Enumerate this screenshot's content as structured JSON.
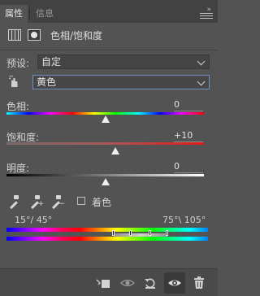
{
  "tabs": [
    {
      "label": "属性",
      "active": true
    },
    {
      "label": "信息",
      "active": false
    }
  ],
  "panel": {
    "title": "色相/饱和度"
  },
  "preset": {
    "label": "预设:",
    "value": "自定"
  },
  "channel": {
    "value": "黄色"
  },
  "sliders": {
    "hue": {
      "label": "色相:",
      "value": "0"
    },
    "saturation": {
      "label": "饱和度:",
      "value": "+10"
    },
    "lightness": {
      "label": "明度:",
      "value": "0"
    }
  },
  "colorize": {
    "label": "着色",
    "checked": false
  },
  "ranges": {
    "left": "15°/ 45°",
    "right": "75°\\ 105°"
  },
  "icons": {
    "adjustment": "adjustment-grid-icon",
    "mask": "mask-icon",
    "target": "hand-target-icon",
    "dropper": "eyedropper-icon",
    "dropper_add": "eyedropper-add-icon",
    "dropper_subtract": "eyedropper-subtract-icon",
    "clip": "clip-to-layer-icon",
    "view_previous": "view-previous-icon",
    "reset": "reset-icon",
    "visibility": "eye-icon",
    "delete": "trash-icon"
  },
  "colors": {
    "panel_bg": "#535353",
    "focus_border": "#6e8fbf"
  }
}
